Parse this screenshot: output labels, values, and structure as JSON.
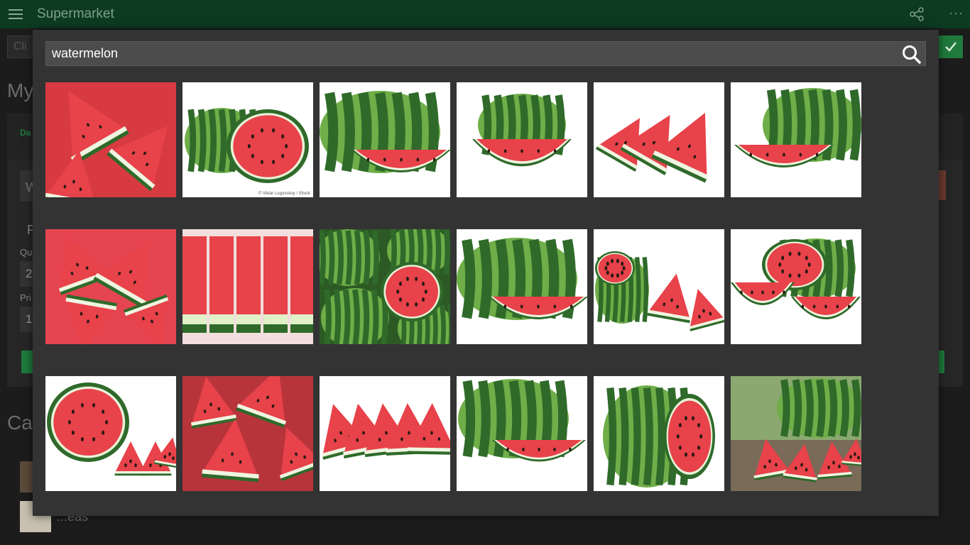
{
  "app": {
    "title": "Supermarket",
    "bg_input_text": "Cli",
    "heading_my": "My",
    "panel_tab": "Da",
    "field_a": "W",
    "label_f": "F",
    "label_qu": "Qu",
    "field_qty": "2",
    "label_pri": "Pri",
    "field_price": "1",
    "heading_car": "Car",
    "list_item_2": "...eas"
  },
  "dialog": {
    "search_value": "watermelon",
    "search_icon": "search-icon",
    "results": [
      {
        "style": "slices-closeup"
      },
      {
        "style": "whole-and-half",
        "caption": "© Viktar Lugovskoy / iStock"
      },
      {
        "style": "whole-and-wedge"
      },
      {
        "style": "whole-and-half-dark"
      },
      {
        "style": "triangle-slices"
      },
      {
        "style": "whole-and-half-wide"
      },
      {
        "style": "slices-closeup-seeds"
      },
      {
        "style": "slice-rows"
      },
      {
        "style": "pile-with-half"
      },
      {
        "style": "whole-and-wedge"
      },
      {
        "style": "cut-pieces"
      },
      {
        "style": "half-and-wedges"
      },
      {
        "style": "half-and-slices"
      },
      {
        "style": "slices-stack"
      },
      {
        "style": "fanned-slices"
      },
      {
        "style": "whole-and-wedge-big"
      },
      {
        "style": "whole-and-half-upright"
      },
      {
        "style": "outdoor-table"
      }
    ]
  },
  "colors": {
    "titlebar": "#0d3b22",
    "accent": "#1f7a3c",
    "dialog_bg": "#333334",
    "rind_dark": "#2f6a2a",
    "rind_light": "#6fae48",
    "flesh": "#e8424a",
    "seed": "#2a1a14"
  }
}
